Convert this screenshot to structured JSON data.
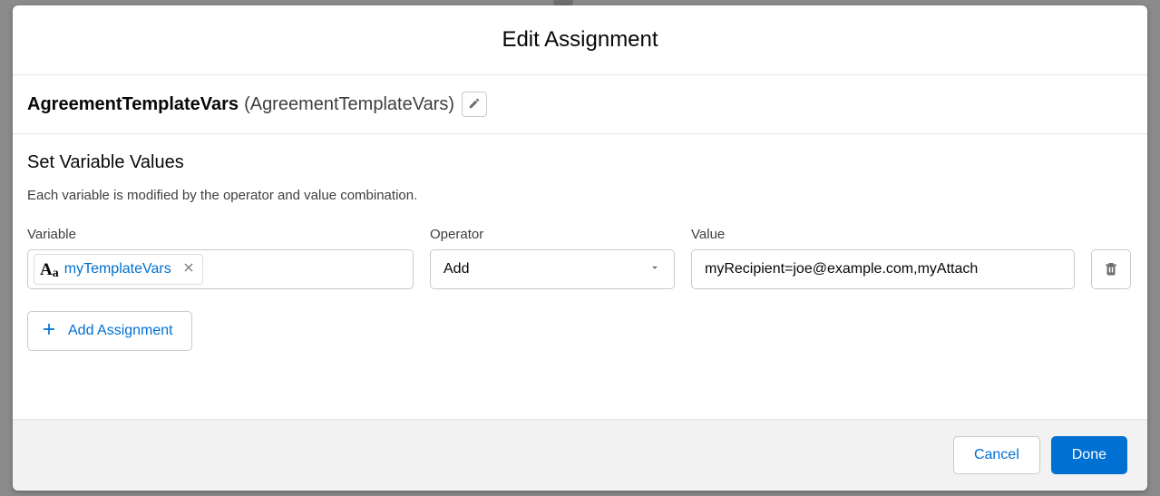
{
  "modal": {
    "title": "Edit Assignment"
  },
  "record": {
    "label": "AgreementTemplateVars",
    "api_name": "(AgreementTemplateVars)"
  },
  "section": {
    "title": "Set Variable Values",
    "description": "Each variable is modified by the operator and value combination."
  },
  "columns": {
    "variable": "Variable",
    "operator": "Operator",
    "value": "Value"
  },
  "assignment": {
    "variable_pill": "myTemplateVars",
    "operator": "Add",
    "value": "myRecipient=joe@example.com,myAttach"
  },
  "buttons": {
    "add_assignment": "Add Assignment",
    "cancel": "Cancel",
    "done": "Done"
  }
}
